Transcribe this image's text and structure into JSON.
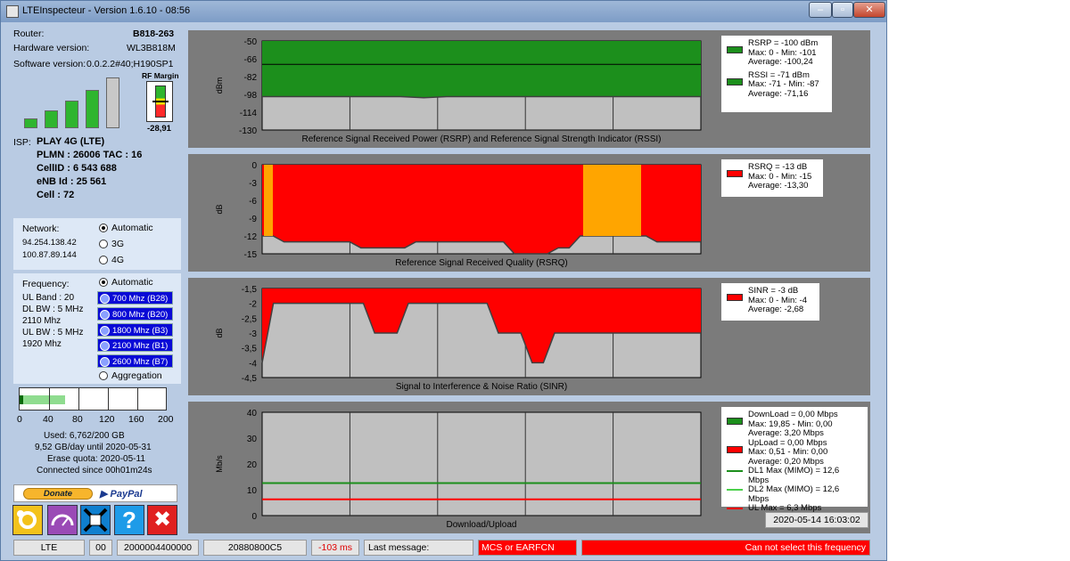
{
  "window": {
    "title": "LTEInspecteur - Version 1.6.10 - 08:56",
    "min": "‒",
    "max": "▫",
    "close": "✕"
  },
  "router": {
    "router_label": "Router:",
    "router_value": "B818-263",
    "hw_label": "Hardware version:",
    "hw_value": "WL3B818M",
    "sw_label": "Software version:",
    "sw_value": "0.0.2.2#40;H190SP1"
  },
  "rf_margin": {
    "label": "RF Margin",
    "value": "-28,91"
  },
  "signal_bars": [
    0.2,
    0.35,
    0.55,
    0.75,
    1.0
  ],
  "isp": {
    "label": "ISP:",
    "name": "PLAY 4G (LTE)",
    "plmn": "PLMN : 26006 TAC : 16",
    "cellid": "CellID : 6 543 688",
    "enb": "eNB Id : 25 561",
    "cell": "Cell : 72"
  },
  "network": {
    "label": "Network:",
    "ip1": "94.254.138.42",
    "ip2": "100.87.89.144",
    "options": [
      "Automatic",
      "3G",
      "4G"
    ],
    "selected": "Automatic"
  },
  "frequency": {
    "label": "Frequency:",
    "ul_band": "UL Band : 20",
    "dl_bw": "DL BW : 5 MHz",
    "dl_freq": "2110 Mhz",
    "ul_bw": "UL BW : 5 MHz",
    "ul_freq": "1920 Mhz",
    "automatic": "Automatic",
    "bands": [
      "700 Mhz (B28)",
      "800 Mhz (B20)",
      "1800 Mhz (B3)",
      "2100 Mhz (B1)",
      "2600 Mhz (B7)"
    ],
    "aggregation": "Aggregation"
  },
  "quota": {
    "ticks": [
      "0",
      "40",
      "80",
      "120",
      "160",
      "200"
    ],
    "used": "Used: 6,762/200 GB",
    "per_day": "9,52 GB/day until 2020-05-31",
    "erase": "Erase quota: 2020-05-11",
    "connected": "Connected since 00h01m24s",
    "used_fraction": 0.034
  },
  "buttons": {
    "donate": "Donate",
    "paypal": "PayPal",
    "settings_icon": "gear-icon",
    "speed_icon": "speedometer-icon",
    "expand_icon": "expand-arrows-icon",
    "help_icon": "help-icon",
    "help_label": "?",
    "quit_icon": "close-icon",
    "quit_label": "✖"
  },
  "chart_data": [
    {
      "type": "area",
      "title": "Reference Signal Received Power (RSRP) and Reference Signal Strength Indicator (RSSI)",
      "ylabel": "dBm",
      "yticks": [
        "-50",
        "-66",
        "-82",
        "-98",
        "-114",
        "-130"
      ],
      "ylim": [
        -130,
        -50
      ],
      "legend": [
        "RSRP = -100 dBm",
        "Max: 0 - Min: -101",
        "Average: -100,24",
        "RSSI = -71 dBm",
        "Max: -71 - Min: -87",
        "Average: -71,16"
      ],
      "series": [
        {
          "name": "RSRP",
          "color": "#1c8f1c",
          "values": [
            -100,
            -100,
            -100,
            -100,
            -100,
            -100,
            -100,
            -101,
            -100,
            -100,
            -100,
            -100,
            -100,
            -100,
            -100,
            -100,
            -100,
            -100,
            -100,
            -100
          ]
        },
        {
          "name": "RSSI",
          "color": "#000000",
          "values": [
            -71,
            -71,
            -71,
            -71,
            -71,
            -71,
            -71,
            -71,
            -71,
            -71,
            -71,
            -71,
            -71,
            -71,
            -71,
            -71,
            -71,
            -71,
            -71,
            -71
          ]
        }
      ]
    },
    {
      "type": "area",
      "title": "Reference Signal Received Quality (RSRQ)",
      "ylabel": "dB",
      "yticks": [
        "0",
        "-3",
        "-6",
        "-9",
        "-12",
        "-15"
      ],
      "ylim": [
        -15,
        0
      ],
      "legend": [
        "RSRQ = -13 dB",
        "Max: 0 - Min: -15",
        "Average: -13,30"
      ],
      "series": [
        {
          "name": "RSRQ",
          "color": "#ff0000",
          "values": [
            -12,
            -12,
            -13,
            -13,
            -13,
            -13,
            -13,
            -13,
            -13,
            -14,
            -14,
            -14,
            -14,
            -14,
            -13,
            -13,
            -13,
            -13,
            -13,
            -13,
            -13,
            -13,
            -13,
            -15,
            -15,
            -15,
            -15,
            -14,
            -14,
            -12,
            -12,
            -12,
            -12,
            -12,
            -12,
            -12,
            -13,
            -13,
            -13,
            -13,
            -13
          ]
        }
      ],
      "warn_color": "#ffa500"
    },
    {
      "type": "area",
      "title": "Signal to Interference & Noise Ratio (SINR)",
      "ylabel": "dB",
      "yticks": [
        "-1,5",
        "-2",
        "-2,5",
        "-3",
        "-3,5",
        "-4",
        "-4,5"
      ],
      "ylim": [
        -4.5,
        -1.5
      ],
      "legend": [
        "SINR = -3 dB",
        "Max: 0 - Min: -4",
        "Average: -2,68"
      ],
      "series": [
        {
          "name": "SINR",
          "color": "#ff0000",
          "values": [
            -4,
            -2,
            -2,
            -2,
            -2,
            -2,
            -2,
            -2,
            -2,
            -2,
            -3,
            -3,
            -3,
            -2,
            -2,
            -2,
            -2,
            -2,
            -2,
            -2,
            -2,
            -3,
            -3,
            -3,
            -4,
            -4,
            -3,
            -3,
            -3,
            -3,
            -3,
            -3,
            -3,
            -3,
            -3,
            -3,
            -3,
            -3,
            -3,
            -3
          ]
        }
      ]
    },
    {
      "type": "line",
      "title": "Download/Upload",
      "ylabel": "Mb/s",
      "yticks": [
        "40",
        "30",
        "20",
        "10",
        "0"
      ],
      "ylim": [
        0,
        40
      ],
      "legend": [
        "DownLoad = 0,00 Mbps",
        "Max: 19,85 - Min: 0,00",
        "Average: 3,20 Mbps",
        "UpLoad = 0,00 Mbps",
        "Max: 0,51 - Min: 0,00",
        "Average: 0,20 Mbps",
        "DL1 Max (MIMO) = 12,6 Mbps",
        "DL2 Max (MIMO) = 12,6 Mbps",
        "UL Max = 6,3 Mbps"
      ],
      "series": [
        {
          "name": "DL1 Max (MIMO)",
          "color": "#1c8f1c",
          "values": [
            12.6,
            12.6,
            12.6,
            12.6,
            12.6,
            12.6,
            12.6,
            12.6,
            12.6,
            12.6,
            12.6,
            12.6,
            12.6,
            12.6,
            12.6,
            12.6,
            12.6,
            12.6,
            12.6,
            12.6
          ]
        },
        {
          "name": "UL Max",
          "color": "#ff0000",
          "values": [
            6.3,
            6.3,
            6.3,
            6.3,
            6.3,
            6.3,
            6.3,
            6.3,
            6.3,
            6.3,
            6.3,
            6.3,
            6.3,
            6.3,
            6.3,
            6.3,
            6.3,
            6.3,
            6.3,
            6.3
          ]
        }
      ],
      "timestamp": "2020-05-14 16:03:02"
    }
  ],
  "statusbar": {
    "mode": "LTE",
    "code": "00",
    "id1": "2000004400000",
    "id2": "20880800C5",
    "latency": "-103 ms",
    "last_msg": "Last message:",
    "mcs": "MCS or EARFCN",
    "error": "Can not select this frequency"
  }
}
